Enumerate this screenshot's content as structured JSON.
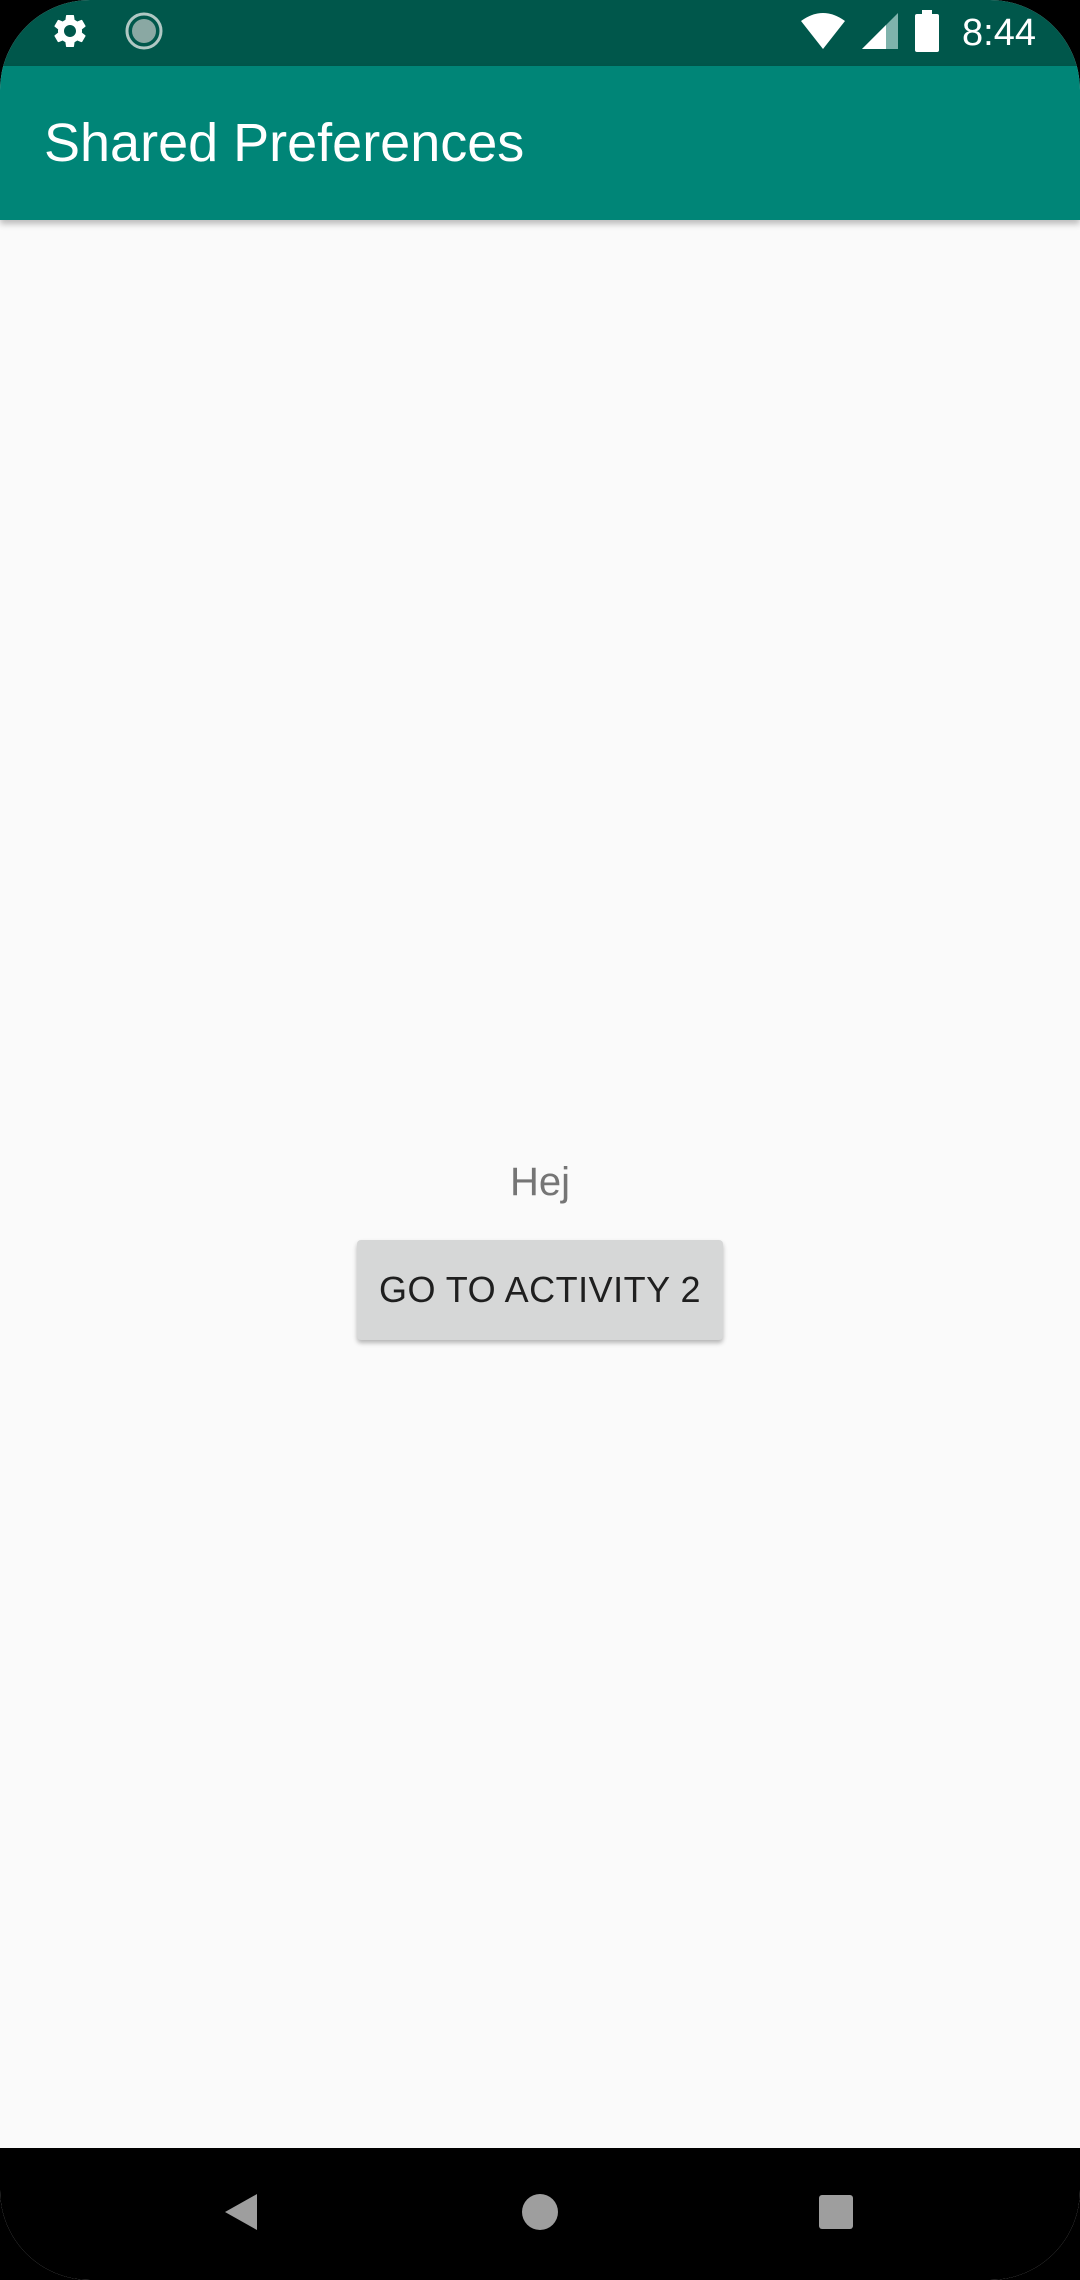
{
  "status_bar": {
    "time": "8:44",
    "left_icons": [
      "settings-icon",
      "sync-icon"
    ],
    "right_icons": [
      "wifi-icon",
      "cell-signal-icon",
      "battery-icon"
    ],
    "background": "#00574b"
  },
  "app_bar": {
    "title": "Shared Preferences",
    "background": "#008577"
  },
  "main": {
    "text": "Hej",
    "button_label": "GO TO ACTIVITY 2"
  },
  "nav_bar": {
    "buttons": [
      "back-icon",
      "home-icon",
      "recents-icon"
    ]
  }
}
